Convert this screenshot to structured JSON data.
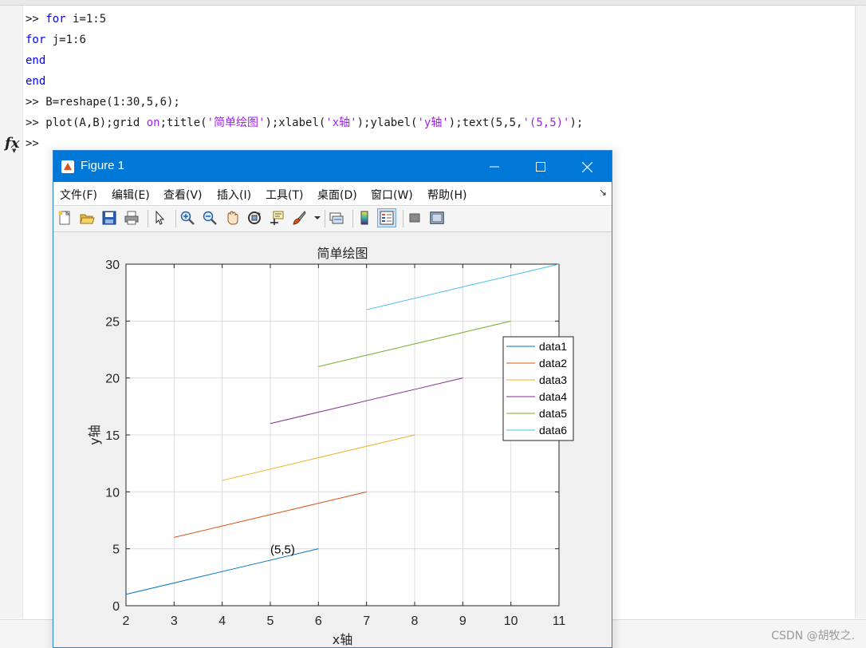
{
  "command_window": {
    "lines": [
      [
        {
          "t": ">> ",
          "c": "plain"
        },
        {
          "t": "for",
          "c": "kw"
        },
        {
          "t": " i=1:5",
          "c": "plain"
        }
      ],
      [
        {
          "t": "for",
          "c": "kw"
        },
        {
          "t": " j=1:6",
          "c": "plain"
        }
      ],
      [
        {
          "t": "end",
          "c": "kw"
        }
      ],
      [
        {
          "t": "end",
          "c": "kw"
        }
      ],
      [
        {
          "t": ">> B=reshape(1:30,5,6);",
          "c": "plain"
        }
      ],
      [
        {
          "t": ">> plot(A,B);grid ",
          "c": "plain"
        },
        {
          "t": "on",
          "c": "str"
        },
        {
          "t": ";title(",
          "c": "plain"
        },
        {
          "t": "'简单绘图'",
          "c": "str"
        },
        {
          "t": ");xlabel(",
          "c": "plain"
        },
        {
          "t": "'x轴'",
          "c": "str"
        },
        {
          "t": ");ylabel(",
          "c": "plain"
        },
        {
          "t": "'y轴'",
          "c": "str"
        },
        {
          "t": ");text(5,5,",
          "c": "plain"
        },
        {
          "t": "'(5,5)'",
          "c": "str"
        },
        {
          "t": ");",
          "c": "plain"
        }
      ],
      [
        {
          "t": ">>",
          "c": "plain"
        }
      ]
    ],
    "prompt_icon": "fx",
    "watermark": "CSDN @胡牧之."
  },
  "figure": {
    "title": "Figure 1",
    "menu": [
      "文件(F)",
      "编辑(E)",
      "查看(V)",
      "插入(I)",
      "工具(T)",
      "桌面(D)",
      "窗口(W)",
      "帮助(H)"
    ],
    "toolbar": [
      {
        "icon": "new-figure-icon",
        "selected": false
      },
      {
        "icon": "open-file-icon",
        "selected": false
      },
      {
        "icon": "save-icon",
        "selected": false
      },
      {
        "icon": "print-icon",
        "selected": false
      },
      {
        "icon": "separator"
      },
      {
        "icon": "pointer-icon",
        "selected": false
      },
      {
        "icon": "separator"
      },
      {
        "icon": "zoom-in-icon",
        "selected": false
      },
      {
        "icon": "zoom-out-icon",
        "selected": false
      },
      {
        "icon": "pan-hand-icon",
        "selected": false
      },
      {
        "icon": "rotate-3d-icon",
        "selected": false
      },
      {
        "icon": "data-cursor-icon",
        "selected": false
      },
      {
        "icon": "brush-icon",
        "selected": false
      },
      {
        "icon": "dropdown-arrow-icon",
        "selected": false
      },
      {
        "icon": "separator"
      },
      {
        "icon": "link-plot-icon",
        "selected": false
      },
      {
        "icon": "separator"
      },
      {
        "icon": "colorbar-icon",
        "selected": false
      },
      {
        "icon": "legend-icon",
        "selected": true
      },
      {
        "icon": "separator"
      },
      {
        "icon": "hide-plot-tools-icon",
        "selected": false
      },
      {
        "icon": "show-plot-tools-icon",
        "selected": false
      }
    ]
  },
  "chart_data": {
    "type": "line",
    "title": "简单绘图",
    "xlabel": "x轴",
    "ylabel": "y轴",
    "xlim": [
      2,
      11
    ],
    "ylim": [
      0,
      30
    ],
    "xticks": [
      2,
      3,
      4,
      5,
      6,
      7,
      8,
      9,
      10,
      11
    ],
    "yticks": [
      0,
      5,
      10,
      15,
      20,
      25,
      30
    ],
    "grid": true,
    "legend_position": "right",
    "series": [
      {
        "name": "data1",
        "color": "#0072bd",
        "x": [
          2,
          3,
          4,
          5,
          6
        ],
        "y": [
          1,
          2,
          3,
          4,
          5
        ]
      },
      {
        "name": "data2",
        "color": "#d95319",
        "x": [
          3,
          4,
          5,
          6,
          7
        ],
        "y": [
          6,
          7,
          8,
          9,
          10
        ]
      },
      {
        "name": "data3",
        "color": "#edb120",
        "x": [
          4,
          5,
          6,
          7,
          8
        ],
        "y": [
          11,
          12,
          13,
          14,
          15
        ]
      },
      {
        "name": "data4",
        "color": "#7e2f8e",
        "x": [
          5,
          6,
          7,
          8,
          9
        ],
        "y": [
          16,
          17,
          18,
          19,
          20
        ]
      },
      {
        "name": "data5",
        "color": "#77ac30",
        "x": [
          6,
          7,
          8,
          9,
          10
        ],
        "y": [
          21,
          22,
          23,
          24,
          25
        ]
      },
      {
        "name": "data6",
        "color": "#4dbeee",
        "x": [
          7,
          8,
          9,
          10,
          11
        ],
        "y": [
          26,
          27,
          28,
          29,
          30
        ]
      }
    ],
    "annotations": [
      {
        "text": "(5,5)",
        "x": 5,
        "y": 5
      }
    ]
  }
}
